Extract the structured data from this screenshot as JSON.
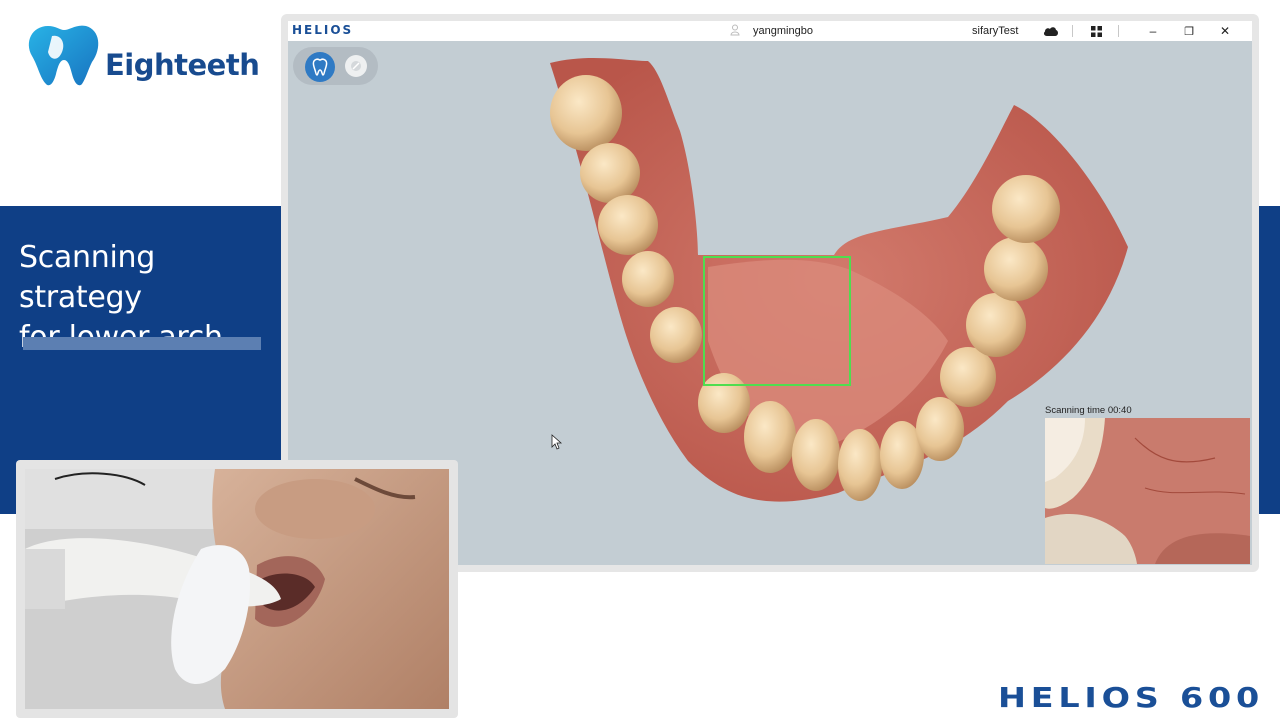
{
  "logo": {
    "name": "Eighteeth",
    "icon": "tooth-logo-icon",
    "color": "#184b8f"
  },
  "headline": {
    "line1": "Scanning strategy",
    "line2": "for lower arch"
  },
  "app": {
    "brand": "HELIOS",
    "user_icon": "user-icon",
    "user": "yangmingbo",
    "project": "sifaryTest",
    "cloud_icon": "cloud-icon",
    "grid_icon": "grid-icon",
    "minimize": "–",
    "restore": "❐",
    "close": "✕",
    "mode_icons": [
      "tooth-scan-icon",
      "mirror-icon"
    ],
    "scan_time_label": "Scanning time",
    "scan_time_value": "00:40"
  },
  "footer_brand": "HELIOS 600",
  "colors": {
    "band": "#0f3f86",
    "accent": "#2f7ac4",
    "scan_box": "#4fdd4f"
  }
}
